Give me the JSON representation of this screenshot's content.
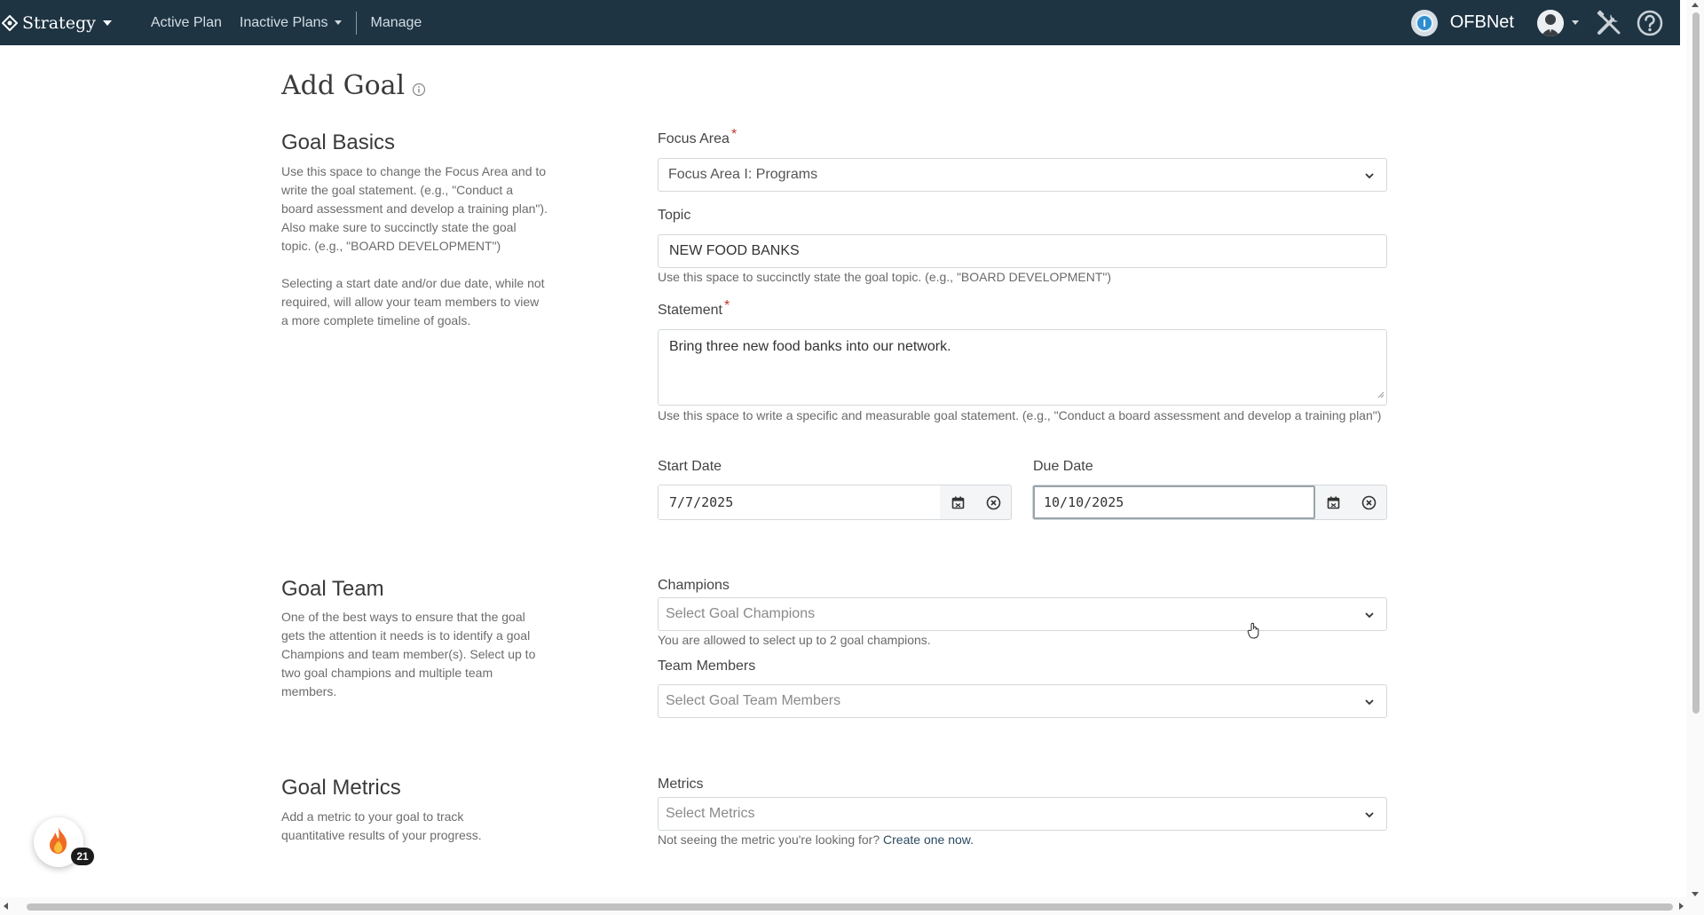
{
  "nav": {
    "brand": "Strategy",
    "active_plan": "Active Plan",
    "inactive_plans": "Inactive Plans",
    "manage": "Manage",
    "org_name": "OFBNet"
  },
  "page": {
    "title": "Add Goal"
  },
  "goal_basics": {
    "heading": "Goal Basics",
    "desc1": "Use this space to change the Focus Area and to write the goal statement. (e.g., \"Conduct a board assessment and develop a training plan\"). Also make sure to succinctly state the goal topic. (e.g., \"BOARD DEVELOPMENT\")",
    "desc2": "Selecting a start date and/or due date, while not required, will allow your team members to view a more complete timeline of goals.",
    "focus_area_label": "Focus Area",
    "focus_area_value": "Focus Area I: Programs",
    "topic_label": "Topic",
    "topic_value": "NEW FOOD BANKS",
    "topic_help": "Use this space to succinctly state the goal topic. (e.g., \"BOARD DEVELOPMENT\")",
    "statement_label": "Statement",
    "statement_value": "Bring three new food banks into our network.",
    "statement_help": "Use this space to write a specific and measurable goal statement. (e.g., \"Conduct a board assessment and develop a training plan\")",
    "start_date_label": "Start Date",
    "start_date_value": "7/7/2025",
    "due_date_label": "Due Date",
    "due_date_value": "10/10/2025",
    "required_marker": "*"
  },
  "goal_team": {
    "heading": "Goal Team",
    "desc": "One of the best ways to ensure that the goal gets the attention it needs is to identify a goal Champions and team member(s). Select up to two goal champions and multiple team members.",
    "champions_label": "Champions",
    "champions_placeholder": "Select Goal Champions",
    "champions_help": "You are allowed to select up to 2 goal champions.",
    "members_label": "Team Members",
    "members_placeholder": "Select Goal Team Members"
  },
  "goal_metrics": {
    "heading": "Goal Metrics",
    "desc": "Add a metric to your goal to track quantitative results of your progress.",
    "metrics_label": "Metrics",
    "metrics_placeholder": "Select Metrics",
    "metrics_help": "Not seeing the metric you're looking for?",
    "create_link": "Create one now."
  },
  "float_badge": {
    "count": "21"
  },
  "colors": {
    "nav_bg": "#1e3443",
    "required": "#c0392b",
    "org_badge": "#2e8ecf"
  }
}
